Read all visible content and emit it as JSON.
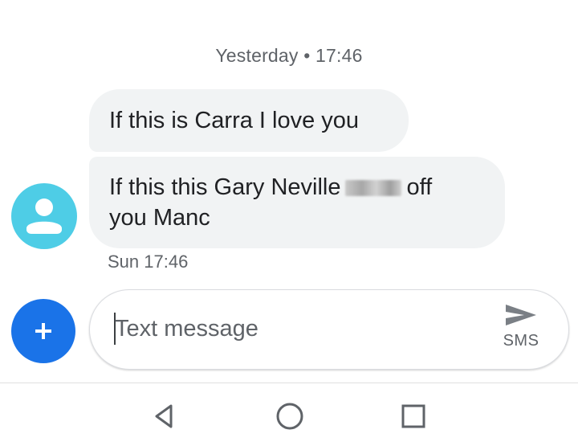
{
  "conversation": {
    "header_timestamp": "Yesterday • 17:46",
    "messages": [
      {
        "text": "If this is Carra I love you"
      },
      {
        "text_before_blur": "If this this Gary Neville",
        "text_after_blur": "off",
        "text_line2": "you Manc",
        "timestamp": "Sun 17:46"
      }
    ]
  },
  "compose": {
    "placeholder": "Text message",
    "send_label": "SMS"
  },
  "icons": {
    "avatar": "person-icon",
    "add": "plus-icon",
    "send": "send-arrow-icon",
    "nav_back": "triangle-back-icon",
    "nav_home": "circle-home-icon",
    "nav_recents": "square-recents-icon"
  },
  "colors": {
    "bubble": "#f1f3f4",
    "avatar": "#4ecde6",
    "add_button": "#1a73e8",
    "muted_text": "#5f6368"
  }
}
